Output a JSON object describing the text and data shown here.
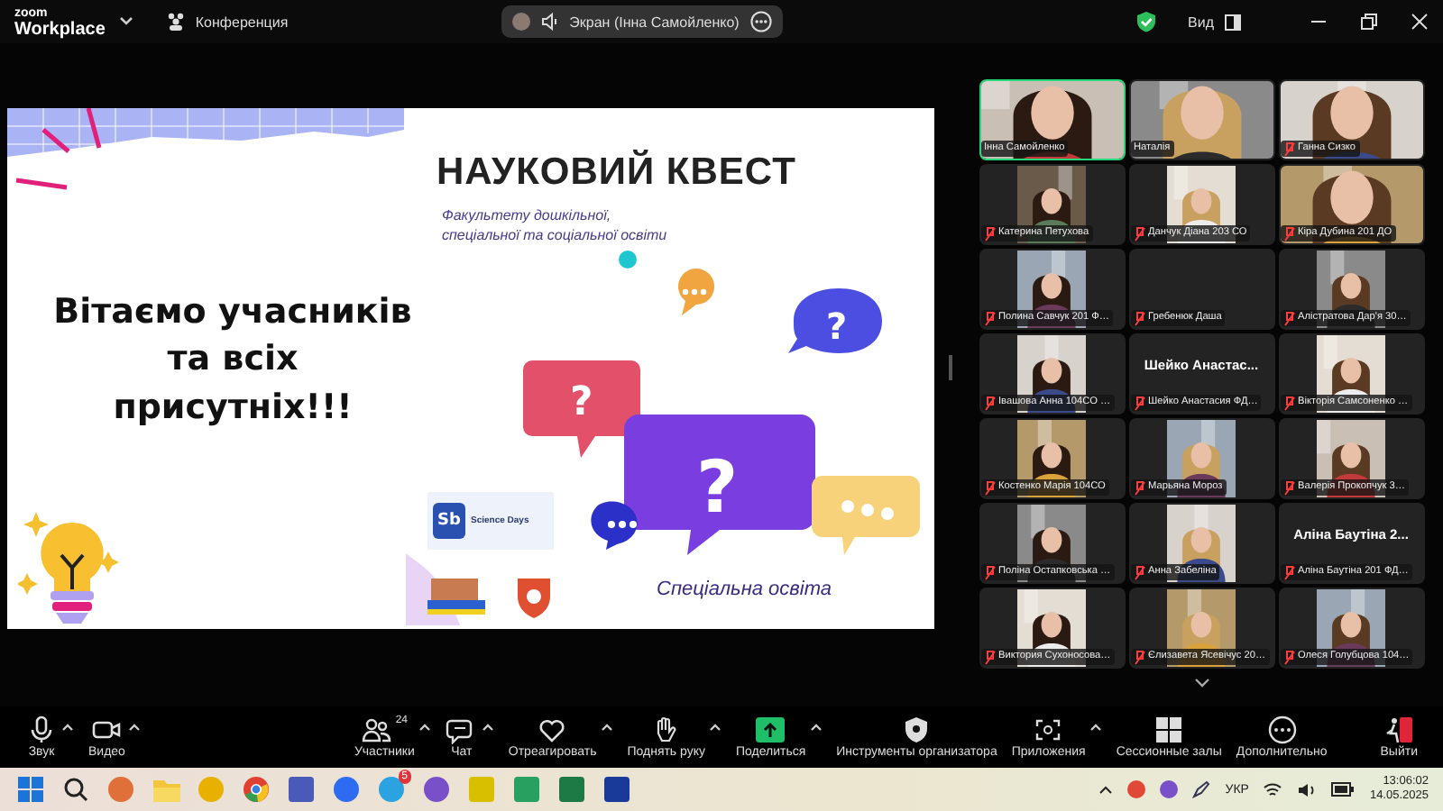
{
  "title_bar": {
    "logo_top": "zoom",
    "logo_bottom": "Workplace",
    "meeting": "Конференция",
    "share_pill": "Экран (Інна Самойленко)",
    "view": "Вид"
  },
  "slide": {
    "title": "НАУКОВИЙ КВЕСТ",
    "subtitle": [
      "Факультету дошкільної,",
      "спеціальної та соціальної освіти"
    ],
    "greeting": [
      "Вітаємо учасників",
      "та всіх",
      "присутніх!!!"
    ],
    "bubble_marks": [
      "?",
      "?",
      "?"
    ],
    "logo_mark": "Sb",
    "logo_text": "Science Days",
    "footer": "Спеціальна освіта"
  },
  "participants": [
    {
      "name": "Інна Самойленко",
      "muted": false,
      "speaking": true,
      "kind": "wide"
    },
    {
      "name": "Наталія",
      "muted": false,
      "speaking": false,
      "kind": "wide"
    },
    {
      "name": "Ганна Сизко",
      "muted": true,
      "speaking": false,
      "kind": "wide"
    },
    {
      "name": "Катерина Петухова",
      "muted": true,
      "speaking": false,
      "kind": "narrow"
    },
    {
      "name": "Данчук Діана 203 СО",
      "muted": true,
      "speaking": false,
      "kind": "narrow"
    },
    {
      "name": "Кіра Дубина 201 ДО",
      "muted": true,
      "speaking": false,
      "kind": "wide"
    },
    {
      "name": "Полина Савчук 201 Ф…",
      "muted": true,
      "speaking": false,
      "kind": "narrow"
    },
    {
      "name": "Гребенюк Даша",
      "muted": true,
      "speaking": false,
      "kind": "empty"
    },
    {
      "name": "Алістратова Дар'я 30…",
      "muted": true,
      "speaking": false,
      "kind": "narrow"
    },
    {
      "name": "Івашова Анна 104СО …",
      "muted": true,
      "speaking": false,
      "kind": "narrow"
    },
    {
      "name": "Шейко Анастасия ФД…",
      "muted": true,
      "speaking": false,
      "kind": "avatar",
      "avatar_name": "Шейко  Анастас..."
    },
    {
      "name": "Вікторія Самсоненко …",
      "muted": true,
      "speaking": false,
      "kind": "narrow"
    },
    {
      "name": "Костенко Марія 104СО",
      "muted": true,
      "speaking": false,
      "kind": "narrow"
    },
    {
      "name": "Марьяна Мороз",
      "muted": true,
      "speaking": false,
      "kind": "narrow"
    },
    {
      "name": "Валерія Прокопчук 3…",
      "muted": true,
      "speaking": false,
      "kind": "narrow"
    },
    {
      "name": "Поліна Остапковська …",
      "muted": true,
      "speaking": false,
      "kind": "narrow"
    },
    {
      "name": "Анна Забеліна",
      "muted": true,
      "speaking": false,
      "kind": "narrow"
    },
    {
      "name": "Аліна Баутіна 201 ФД…",
      "muted": true,
      "speaking": false,
      "kind": "avatar",
      "avatar_name": "Аліна  Баутіна  2..."
    },
    {
      "name": "Виктория Сухоносова…",
      "muted": true,
      "speaking": false,
      "kind": "narrow"
    },
    {
      "name": "Єлизавета Ясевічус 20…",
      "muted": true,
      "speaking": false,
      "kind": "narrow"
    },
    {
      "name": "Олеся Голубцова 104…",
      "muted": true,
      "speaking": false,
      "kind": "narrow"
    }
  ],
  "toolbar": [
    {
      "kind": "mic",
      "label": "Звук",
      "menu": true
    },
    {
      "kind": "camera",
      "label": "Видео",
      "menu": true
    },
    {
      "kind": "people",
      "label": "Участники",
      "count": "24",
      "menu": true
    },
    {
      "kind": "chat",
      "label": "Чат",
      "menu": true
    },
    {
      "kind": "heart",
      "label": "Отреагировать",
      "menu": true
    },
    {
      "kind": "hand",
      "label": "Поднять руку",
      "menu": true
    },
    {
      "kind": "share",
      "label": "Поделиться",
      "menu": true
    },
    {
      "kind": "shield",
      "label": "Инструменты организатора",
      "menu": false
    },
    {
      "kind": "apps",
      "label": "Приложения",
      "menu": true
    },
    {
      "kind": "rooms",
      "label": "Сессионные залы",
      "menu": false
    },
    {
      "kind": "more",
      "label": "Дополнительно",
      "menu": false
    },
    {
      "kind": "leave",
      "label": "Выйти",
      "menu": false
    }
  ],
  "taskbar": {
    "apps": [
      {
        "kind": "start"
      },
      {
        "kind": "search"
      },
      {
        "kind": "round",
        "color": "#e0703a"
      },
      {
        "kind": "folder"
      },
      {
        "kind": "round",
        "color": "#e8b000"
      },
      {
        "kind": "chrome"
      },
      {
        "kind": "square",
        "color": "#4a5ab8"
      },
      {
        "kind": "round",
        "color": "#2d6bf0"
      },
      {
        "kind": "round",
        "color": "#2aa3e0",
        "badge": "5"
      },
      {
        "kind": "round",
        "color": "#7a50c8"
      },
      {
        "kind": "square",
        "color": "#d8c000"
      },
      {
        "kind": "square",
        "color": "#28a060"
      },
      {
        "kind": "square",
        "color": "#1d7a45"
      },
      {
        "kind": "square",
        "color": "#1a3a9a"
      }
    ],
    "language": "УКР",
    "time": "13:06:02",
    "date": "14.05.2025"
  }
}
